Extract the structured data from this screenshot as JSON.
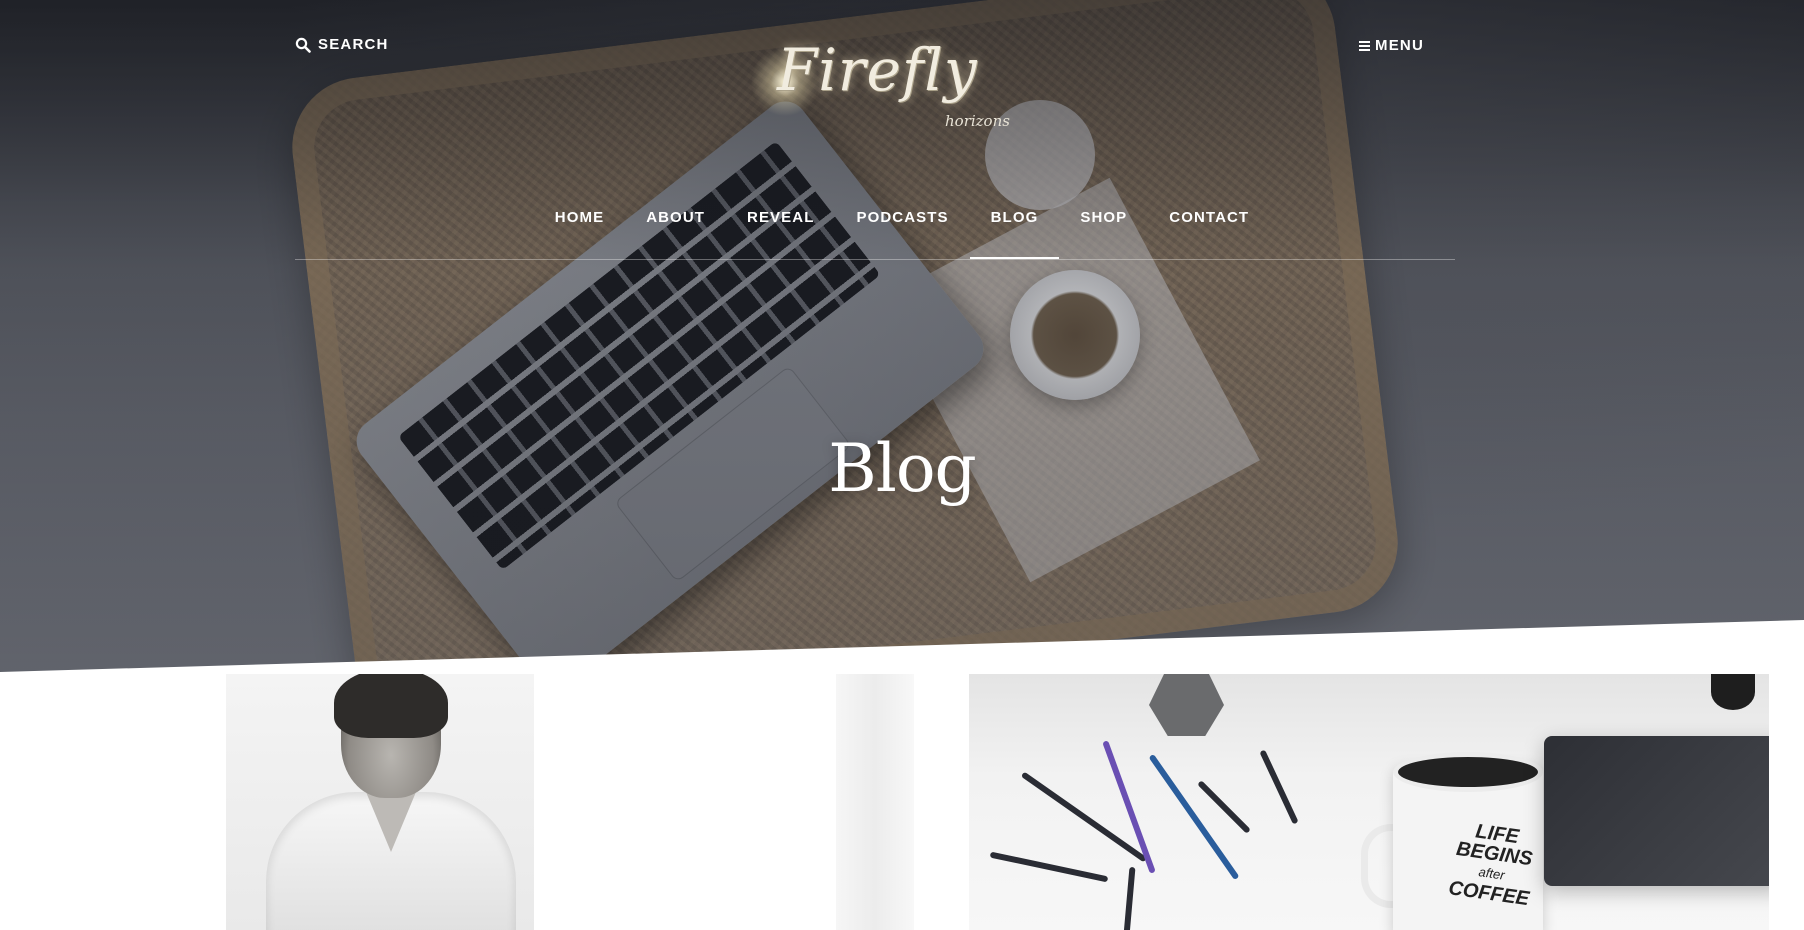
{
  "header": {
    "search_label": "SEARCH",
    "menu_label": "MENU",
    "logo": {
      "main": "Firefly",
      "sub": "horizons"
    }
  },
  "nav": {
    "items": [
      {
        "label": "HOME",
        "active": false
      },
      {
        "label": "ABOUT",
        "active": false
      },
      {
        "label": "REVEAL",
        "active": false
      },
      {
        "label": "PODCASTS",
        "active": false
      },
      {
        "label": "BLOG",
        "active": true
      },
      {
        "label": "SHOP",
        "active": false
      },
      {
        "label": "CONTACT",
        "active": false
      }
    ]
  },
  "page": {
    "title": "Blog"
  },
  "posts": {
    "mug_line1": "LIFE",
    "mug_line2": "BEGINS",
    "mug_line3": "after",
    "mug_line4": "COFFEE"
  },
  "colors": {
    "header_text": "#ffffff",
    "page_bg": "#ffffff",
    "hero_overlay": "#2e3036"
  },
  "icons": {
    "search": "search-icon",
    "menu": "hamburger-icon"
  }
}
